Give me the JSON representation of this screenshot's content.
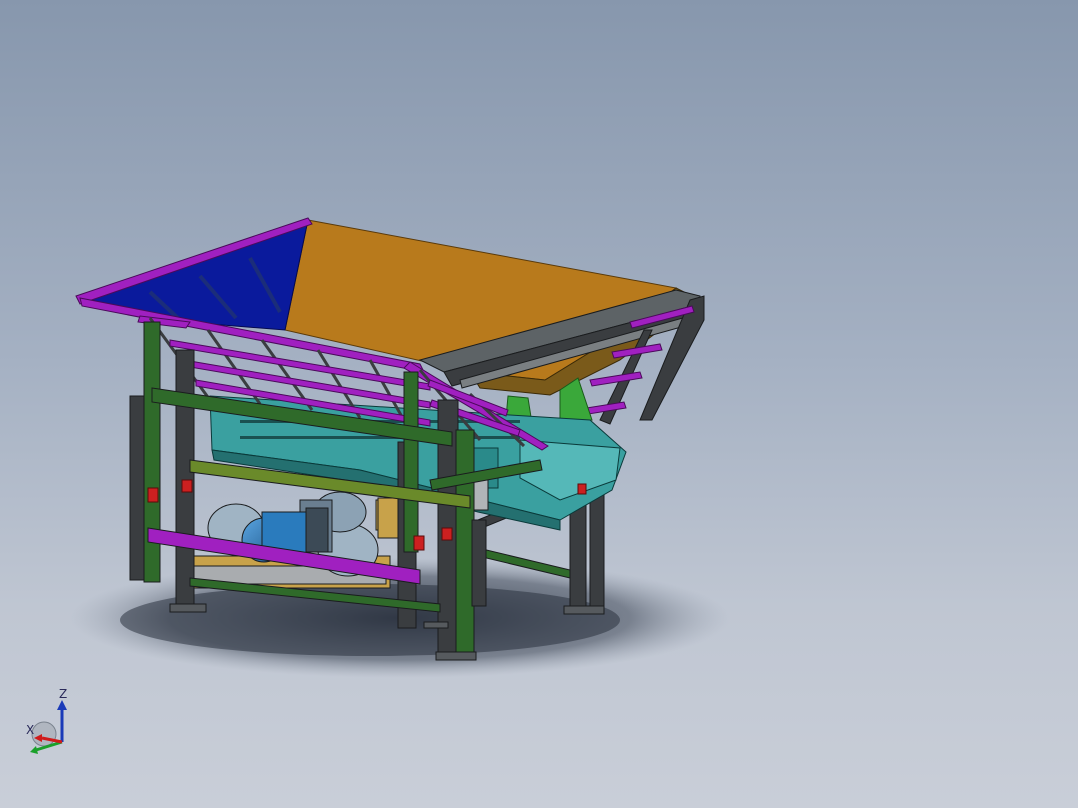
{
  "viewport": {
    "background_top": "#8797ad",
    "background_bottom": "#c9ced8"
  },
  "model": {
    "colors": {
      "hopper_left_wall": "#0a1a9c",
      "hopper_back_wall": "#b87a1c",
      "rim_frame": "#a020c0",
      "structural_steel": "#3a3d40",
      "green_members": "#2f6a2a",
      "feeder_body": "#3aa0a0",
      "motor": "#2a7bbd",
      "feet_accent": "#cc2020",
      "liner_green": "#3aa83a",
      "mount_plate": "#c8a24a"
    }
  },
  "triad": {
    "z_label": "Z",
    "x_label": "X",
    "icon": "coordinate-triad-icon"
  }
}
